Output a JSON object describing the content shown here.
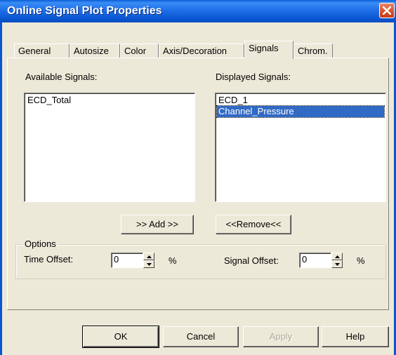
{
  "window": {
    "title": "Online Signal Plot Properties"
  },
  "tabs": [
    {
      "label": "General"
    },
    {
      "label": "Autosize"
    },
    {
      "label": "Color"
    },
    {
      "label": "Axis/Decoration"
    },
    {
      "label": "Signals"
    },
    {
      "label": "Chrom."
    }
  ],
  "available": {
    "label": "Available Signals:",
    "items": [
      "ECD_Total"
    ]
  },
  "displayed": {
    "label": "Displayed Signals:",
    "items": [
      "ECD_1",
      "Channel_Pressure"
    ],
    "selected": "Channel_Pressure"
  },
  "buttons": {
    "add": ">> Add >>",
    "remove": "<<Remove<<",
    "ok": "OK",
    "cancel": "Cancel",
    "apply": "Apply",
    "help": "Help"
  },
  "options": {
    "group_label": "Options",
    "time_offset_label": "Time Offset:",
    "time_offset_value": "0",
    "time_offset_unit": "%",
    "signal_offset_label": "Signal Offset:",
    "signal_offset_value": "0",
    "signal_offset_unit": "%"
  },
  "icons": {
    "close": "close-icon",
    "spin_up": "spin-up-icon",
    "spin_down": "spin-down-icon"
  },
  "colors": {
    "titlebar": "#0a55d0",
    "selection": "#316ac5",
    "face": "#ece9d8"
  }
}
